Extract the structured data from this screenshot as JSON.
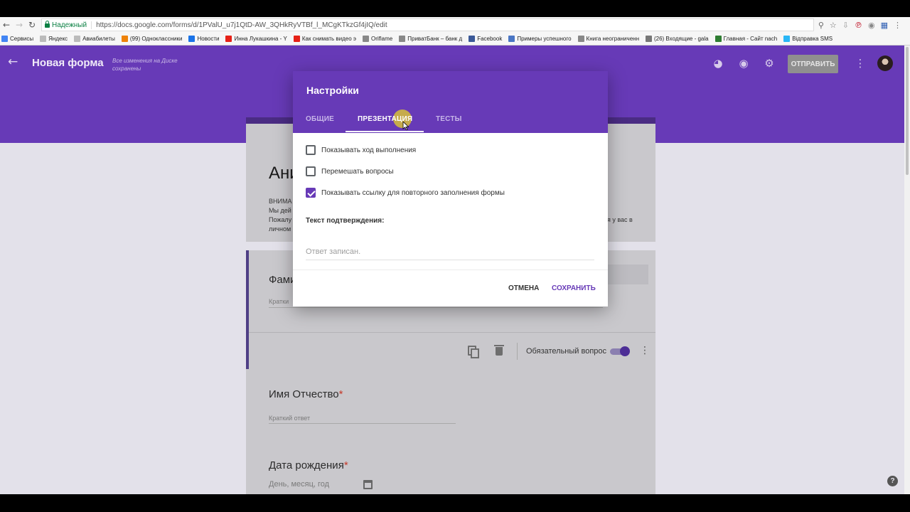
{
  "browser": {
    "secure_label": "Надежный",
    "url": "https://docs.google.com/forms/d/1PValU_u7j1QtD-AW_3QHkRyVTBf_l_MCgKTkzGf4jIQ/edit",
    "bookmarks": [
      {
        "label": "Сервисы",
        "color": "#4285f4"
      },
      {
        "label": "Яндекс",
        "color": "#bbbbbb"
      },
      {
        "label": "Авиабилеты",
        "color": "#bbbbbb"
      },
      {
        "label": "(99) Одноклассники",
        "color": "#ee8208"
      },
      {
        "label": "Новости",
        "color": "#1a73e8"
      },
      {
        "label": "Инна Лукашкина - Y",
        "color": "#e62117"
      },
      {
        "label": "Как снимать видео э",
        "color": "#e62117"
      },
      {
        "label": "Oriflame",
        "color": "#888888"
      },
      {
        "label": "ПриватБанк – банк д",
        "color": "#888888"
      },
      {
        "label": "Facebook",
        "color": "#3b5998"
      },
      {
        "label": "Примеры успешного",
        "color": "#4a76c4"
      },
      {
        "label": "Книга неограниченн",
        "color": "#888888"
      },
      {
        "label": "(26) Входящие - gala",
        "color": "#777777"
      },
      {
        "label": "Главная - Сайт nach",
        "color": "#2e7d32"
      },
      {
        "label": "Відправка SMS",
        "color": "#29b6f6"
      }
    ]
  },
  "header": {
    "title": "Новая форма",
    "save_status": "Все изменения на Диске сохранены",
    "send_label": "ОТПРАВИТЬ"
  },
  "form": {
    "title_partial": "Ани",
    "notice_lines": [
      "ВНИМА",
      " Мы дей",
      "Пожалу",
      "личном"
    ],
    "notice_right": "я у вас в",
    "q1_title_partial": "Фами",
    "q1_hint_partial": "Кратки",
    "required_label": "Обязательный вопрос",
    "q2_title": "Имя Отчество",
    "q2_hint": "Краткий ответ",
    "q3_title": "Дата рождения",
    "q3_hint": "День, месяц, год",
    "required_mark": "*"
  },
  "dialog": {
    "title": "Настройки",
    "tabs": [
      {
        "label": "ОБЩИЕ",
        "active": false
      },
      {
        "label": "ПРЕЗЕНТАЦИЯ",
        "active": true
      },
      {
        "label": "ТЕСТЫ",
        "active": false
      }
    ],
    "options": [
      {
        "label": "Показывать ход выполнения",
        "checked": false
      },
      {
        "label": "Перемешать вопросы",
        "checked": false
      },
      {
        "label": "Показывать ссылку для повторного заполнения формы",
        "checked": true
      }
    ],
    "confirmation_label": "Текст подтверждения:",
    "confirmation_placeholder": "Ответ записан.",
    "cancel_label": "ОТМЕНА",
    "save_label": "СОХРАНИТЬ"
  },
  "colors": {
    "brand": "#673ab7",
    "accent_text": "#673ab7",
    "required": "#c53929"
  },
  "icons": [
    "back-arrow-icon",
    "reload-icon",
    "palette-icon",
    "preview-eye-icon",
    "settings-gear-icon",
    "more-vert-icon",
    "copy-icon",
    "trash-icon",
    "calendar-icon",
    "help-icon",
    "cursor-icon"
  ]
}
